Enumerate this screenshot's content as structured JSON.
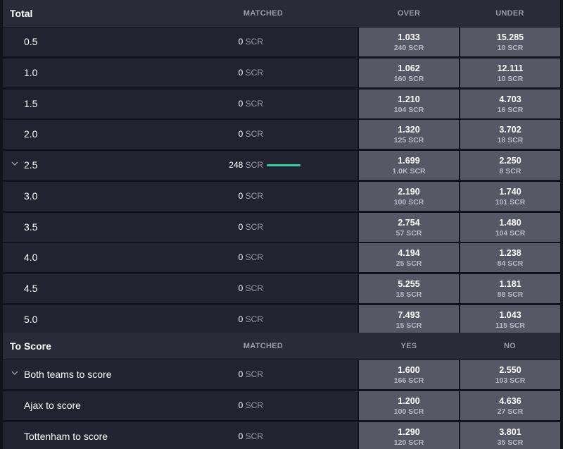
{
  "total": {
    "title": "Total",
    "col_matched": "MATCHED",
    "col_back": "OVER",
    "col_lay": "UNDER",
    "rows": [
      {
        "label": "0.5",
        "matched_num": "0",
        "matched_unit": "SCR",
        "back_odds": "1.033",
        "back_stake": "240 SCR",
        "lay_odds": "15.285",
        "lay_stake": "10 SCR"
      },
      {
        "label": "1.0",
        "matched_num": "0",
        "matched_unit": "SCR",
        "back_odds": "1.062",
        "back_stake": "160 SCR",
        "lay_odds": "12.111",
        "lay_stake": "10 SCR"
      },
      {
        "label": "1.5",
        "matched_num": "0",
        "matched_unit": "SCR",
        "back_odds": "1.210",
        "back_stake": "104 SCR",
        "lay_odds": "4.703",
        "lay_stake": "16 SCR"
      },
      {
        "label": "2.0",
        "matched_num": "0",
        "matched_unit": "SCR",
        "back_odds": "1.320",
        "back_stake": "125 SCR",
        "lay_odds": "3.702",
        "lay_stake": "18 SCR"
      },
      {
        "label": "2.5",
        "matched_num": "248",
        "matched_unit": "SCR",
        "back_odds": "1.699",
        "back_stake": "1.0K SCR",
        "lay_odds": "2.250",
        "lay_stake": "8 SCR"
      },
      {
        "label": "3.0",
        "matched_num": "0",
        "matched_unit": "SCR",
        "back_odds": "2.190",
        "back_stake": "100 SCR",
        "lay_odds": "1.740",
        "lay_stake": "101 SCR"
      },
      {
        "label": "3.5",
        "matched_num": "0",
        "matched_unit": "SCR",
        "back_odds": "2.754",
        "back_stake": "57 SCR",
        "lay_odds": "1.480",
        "lay_stake": "104 SCR"
      },
      {
        "label": "4.0",
        "matched_num": "0",
        "matched_unit": "SCR",
        "back_odds": "4.194",
        "back_stake": "25 SCR",
        "lay_odds": "1.238",
        "lay_stake": "84 SCR"
      },
      {
        "label": "4.5",
        "matched_num": "0",
        "matched_unit": "SCR",
        "back_odds": "5.255",
        "back_stake": "18 SCR",
        "lay_odds": "1.181",
        "lay_stake": "88 SCR"
      },
      {
        "label": "5.0",
        "matched_num": "0",
        "matched_unit": "SCR",
        "back_odds": "7.493",
        "back_stake": "15 SCR",
        "lay_odds": "1.043",
        "lay_stake": "115 SCR"
      }
    ]
  },
  "to_score": {
    "title": "To Score",
    "col_matched": "MATCHED",
    "col_back": "YES",
    "col_lay": "NO",
    "rows": [
      {
        "label": "Both teams to score",
        "matched_num": "0",
        "matched_unit": "SCR",
        "back_odds": "1.600",
        "back_stake": "166 SCR",
        "lay_odds": "2.550",
        "lay_stake": "103 SCR"
      },
      {
        "label": "Ajax to score",
        "matched_num": "0",
        "matched_unit": "SCR",
        "back_odds": "1.200",
        "back_stake": "100 SCR",
        "lay_odds": "4.636",
        "lay_stake": "27 SCR"
      },
      {
        "label": "Tottenham to score",
        "matched_num": "0",
        "matched_unit": "SCR",
        "back_odds": "1.290",
        "back_stake": "120 SCR",
        "lay_odds": "3.801",
        "lay_stake": "35 SCR"
      }
    ]
  },
  "colors": {
    "background": "#13131d",
    "header": "#2a2b39",
    "row": "#222331",
    "odds_cell": "#575866",
    "matched_bar": "#2dd4a0"
  }
}
